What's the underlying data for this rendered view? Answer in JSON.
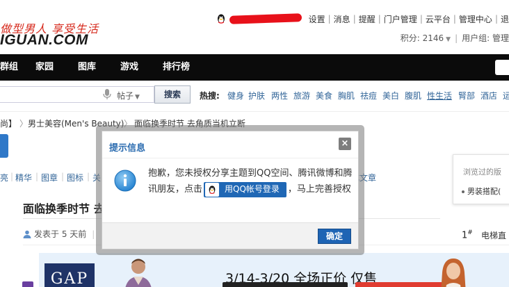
{
  "header": {
    "logo_slogan": "做型男人 享受生活",
    "logo_text": "IGUAN.COM",
    "userbar": [
      "设置",
      "消息",
      "提醒",
      "门户管理",
      "云平台",
      "管理中心",
      "退"
    ],
    "points": "积分: 2146",
    "usergroup": "用户组: 管理"
  },
  "nav": {
    "items": [
      "群组",
      "家园",
      "图库",
      "游戏",
      "排行榜"
    ]
  },
  "search": {
    "placeholder": "",
    "scope": "帖子",
    "button": "搜索",
    "hot_label": "热搜:",
    "hot_links": [
      "健身",
      "护肤",
      "两性",
      "旅游",
      "美食",
      "胸肌",
      "祛痘",
      "美白",
      "腹肌",
      "性生活",
      "腎部",
      "酒店",
      "运"
    ]
  },
  "breadcrumb": {
    "items": [
      "尚】",
      "男士美容(Men's Beauty)",
      "面临换季时节 去角质当机立断"
    ]
  },
  "filters": {
    "items": [
      "亮",
      "精华",
      "图章",
      "图标",
      "关"
    ],
    "extra": "成文章"
  },
  "thread": {
    "title": "面临换季时节 去",
    "posted": "发表于 5 天前",
    "floor": "1",
    "floor_suffix": "#",
    "elevator": "电梯直"
  },
  "banner": {
    "brand": "GAP",
    "promo": "3/14-3/20 全场正价  仅售"
  },
  "side_panel": {
    "title": "浏览过的版",
    "item": "男装搭配("
  },
  "modal": {
    "title": "提示信息",
    "close": "×",
    "msg_before": "抱歉，您未授权分享主题到QQ空间、腾讯微博和腾讯朋友，点击",
    "qq_button": "用QQ帐号登录",
    "msg_after": "，马上完善授权",
    "confirm": "确定"
  },
  "colors": {
    "nav_bg": "#0b0b0b",
    "link": "#336699",
    "accent_blue": "#1e64b4",
    "logo_red": "#d6281b"
  }
}
